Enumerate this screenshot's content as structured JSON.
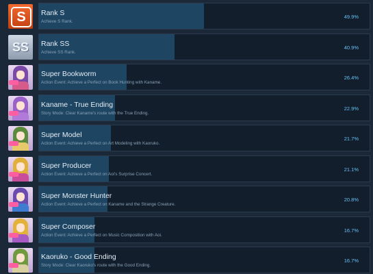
{
  "achievements": [
    {
      "title": "Rank S",
      "desc": "Achieve S Rank.",
      "pct": "49.9%",
      "pct_value": 0.499,
      "icon": "rank-s-icon",
      "letter": "S"
    },
    {
      "title": "Rank SS",
      "desc": "Achieve SS Rank.",
      "pct": "40.9%",
      "pct_value": 0.409,
      "icon": "rank-ss-icon",
      "letter": "SS"
    },
    {
      "title": "Super Bookworm",
      "desc": "Action Event: Achieve a Perfect on Book Hunting with Kaname.",
      "pct": "26.4%",
      "pct_value": 0.264,
      "icon": "character-portrait-icon",
      "hair": "#7b4aa8",
      "body": "#d65a8a"
    },
    {
      "title": "Kaname - True Ending",
      "desc": "Story Mode: Clear Kaname's route with the True Ending.",
      "pct": "22.9%",
      "pct_value": 0.229,
      "icon": "character-portrait-icon",
      "hair": "#9a62c9",
      "body": "#b07ad8"
    },
    {
      "title": "Super Model",
      "desc": "Action Event: Achieve a Perfect on Art Modeling with Kaoruko.",
      "pct": "21.7%",
      "pct_value": 0.217,
      "icon": "character-portrait-icon",
      "hair": "#5b8a3c",
      "body": "#e7c86a"
    },
    {
      "title": "Super Producer",
      "desc": "Action Event: Achieve a Perfect on Aoi's Surprise Concert.",
      "pct": "21.1%",
      "pct_value": 0.211,
      "icon": "character-portrait-icon",
      "hair": "#e0b03a",
      "body": "#c94d9a"
    },
    {
      "title": "Super Monster Hunter",
      "desc": "Action Event: Achieve a Perfect on Kaname and the Strange Creature.",
      "pct": "20.8%",
      "pct_value": 0.208,
      "icon": "character-portrait-icon",
      "hair": "#6a4bb0",
      "body": "#3f7bd0"
    },
    {
      "title": "Super Composer",
      "desc": "Action Event: Achieve a Perfect on Music Composition with Aoi.",
      "pct": "16.7%",
      "pct_value": 0.167,
      "icon": "character-portrait-icon",
      "hair": "#e3b23a",
      "body": "#a85ac4"
    },
    {
      "title": "Kaoruko - Good Ending",
      "desc": "Story Mode: Clear Kaoruko's route with the Good Ending.",
      "pct": "16.7%",
      "pct_value": 0.167,
      "icon": "character-portrait-icon",
      "hair": "#6f9a40",
      "body": "#d8d0a0"
    }
  ],
  "colors": {
    "background": "#1b2838",
    "progress_fill": "#1e4663",
    "percent_text": "#66c0f4"
  }
}
